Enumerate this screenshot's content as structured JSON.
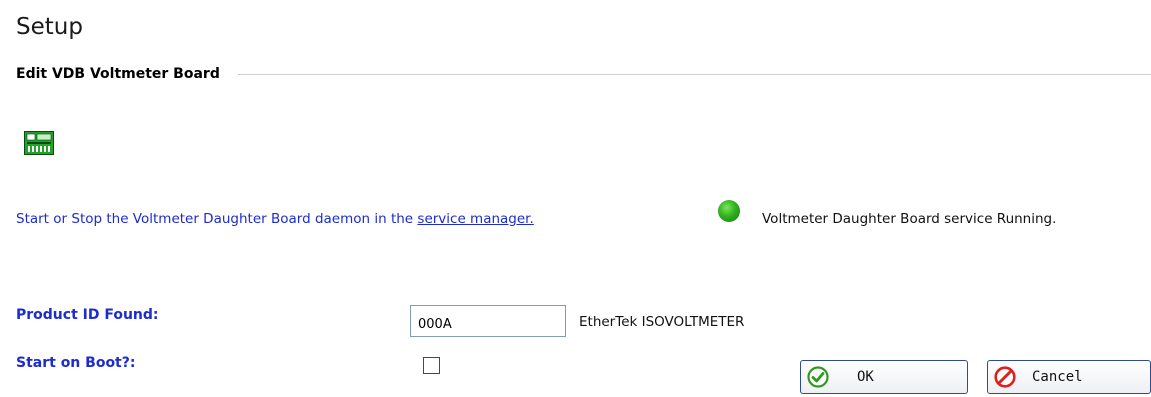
{
  "page": {
    "title": "Setup"
  },
  "section": {
    "title": "Edit VDB Voltmeter Board"
  },
  "daemon": {
    "text": "Start or Stop the Voltmeter Daughter Board daemon in the ",
    "link": "service manager."
  },
  "status": {
    "text": "Voltmeter Daughter Board service Running.",
    "color": "#2fb11d"
  },
  "product_id": {
    "label": "Product ID Found:",
    "value": "000A",
    "description": "EtherTek ISOVOLTMETER"
  },
  "start_on_boot": {
    "label": "Start on Boot?:",
    "checked": false
  },
  "buttons": {
    "ok": "OK",
    "cancel": "Cancel"
  },
  "colors": {
    "label_blue": "#1d2ccf",
    "ok_green": "#2d9a1f",
    "cancel_red": "#e0201b"
  }
}
